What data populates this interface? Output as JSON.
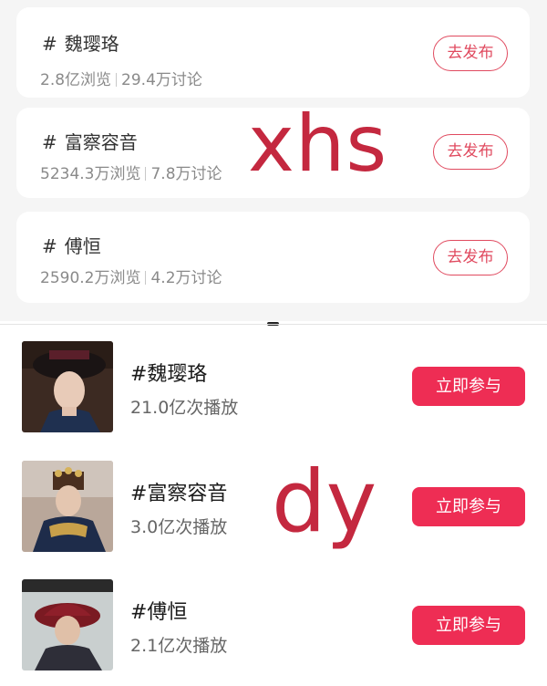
{
  "xhs": {
    "topics": [
      {
        "hash": "#",
        "title": "魏璎珞",
        "views": "2.8亿浏览",
        "discussions": "29.4万讨论",
        "button": "去发布"
      },
      {
        "hash": "#",
        "title": "富察容音",
        "views": "5234.3万浏览",
        "discussions": "7.8万讨论",
        "button": "去发布"
      },
      {
        "hash": "#",
        "title": "傅恒",
        "views": "2590.2万浏览",
        "discussions": "4.2万讨论",
        "button": "去发布"
      }
    ]
  },
  "dy": {
    "topics": [
      {
        "title": "#魏璎珞",
        "plays": "21.0亿次播放",
        "button": "立即参与",
        "thumb_icon": "portrait-thumbnail"
      },
      {
        "title": "#富察容音",
        "plays": "3.0亿次播放",
        "button": "立即参与",
        "thumb_icon": "portrait-thumbnail"
      },
      {
        "title": "#傅恒",
        "plays": "2.1亿次播放",
        "button": "立即参与",
        "thumb_icon": "portrait-thumbnail"
      }
    ]
  },
  "watermarks": {
    "top": "xhs",
    "bottom": "dy"
  },
  "colors": {
    "accent": "#ee2d54",
    "outline_button": "#e04a5f",
    "watermark": "#c4283f",
    "background": "#f5f5f5"
  }
}
